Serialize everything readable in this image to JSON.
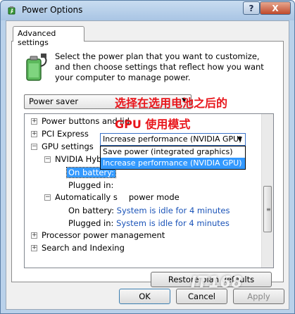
{
  "window": {
    "title": "Power Options",
    "help_label": "?",
    "close_label": "X"
  },
  "tab": {
    "label": "Advanced settings"
  },
  "intro": {
    "text": "Select the power plan that you want to customize, and then choose settings that reflect how you want your computer to manage power."
  },
  "plan": {
    "selected": "Power saver"
  },
  "tree": {
    "power_buttons": "Power buttons and lid",
    "pci_express": "PCI Express",
    "gpu_settings": "GPU settings",
    "hybrid_sli": "NVIDIA Hybrid SLI",
    "on_battery_label": "On battery:",
    "on_battery_value": "Increase performance (NVIDIA GPU)",
    "plugged_in_label": "Plugged in:",
    "auto_switch": "Automatically s",
    "auto_switch_tail": "power mode",
    "auto_on_battery_label": "On battery:",
    "auto_on_battery_value": "System is idle for 4 minutes",
    "auto_plugged_in_label": "Plugged in:",
    "auto_plugged_in_value": "System is idle for 4 minutes",
    "processor": "Processor power management",
    "search": "Search and Indexing"
  },
  "dropdown": {
    "options": [
      "Save power (integrated graphics)",
      "Increase performance (NVIDIA GPU)"
    ]
  },
  "annotation": {
    "line1": "选择在选用电池之后的",
    "line2": "GPU 使用模式"
  },
  "buttons": {
    "restore": "Restore plan defaults",
    "ok": "OK",
    "cancel": "Cancel",
    "apply": "Apply"
  },
  "watermark": {
    "text": "IT168"
  },
  "icons": {
    "expand": "expand-icon",
    "collapse": "collapse-icon",
    "battery": "battery-plug-icon"
  },
  "colors": {
    "selection": "#3399ff",
    "link_value": "#1a53b8",
    "annotation": "#e8151b"
  }
}
